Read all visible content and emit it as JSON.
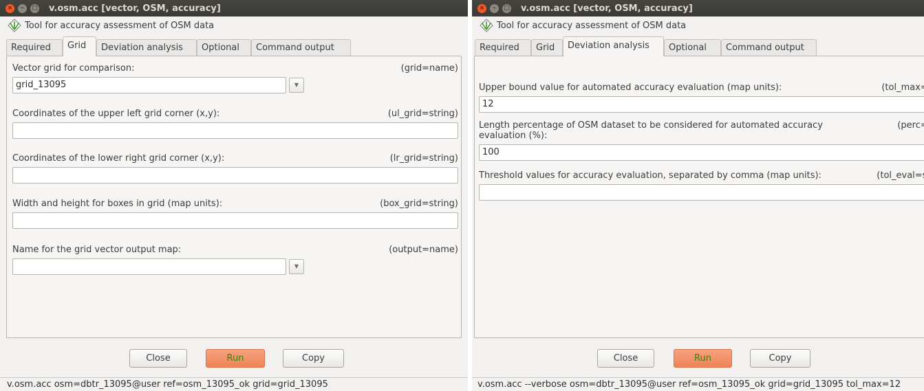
{
  "left": {
    "title": "v.osm.acc [vector, OSM, accuracy]",
    "description": "Tool for accuracy assessment of OSM data",
    "tabs": [
      "Required",
      "Grid",
      "Deviation analysis",
      "Optional",
      "Command output"
    ],
    "active_tab": "Grid",
    "fields": [
      {
        "label": "Vector grid for comparison:",
        "key": "(grid=name)",
        "value": ""
      },
      {
        "label": "Coordinates of the upper left grid corner (x,y):",
        "key": "(ul_grid=string)",
        "value": ""
      },
      {
        "label": "Coordinates of the lower right grid corner (x,y):",
        "key": "(lr_grid=string)",
        "value": ""
      },
      {
        "label": "Width and height for boxes in grid (map units):",
        "key": "(box_grid=string)",
        "value": ""
      },
      {
        "label": "Name for the grid vector output map:",
        "key": "(output=name)",
        "value": ""
      }
    ],
    "grid_value": "grid_13095",
    "buttons": {
      "close": "Close",
      "run": "Run",
      "copy": "Copy"
    },
    "command": "v.osm.acc osm=dbtr_13095@user ref=osm_13095_ok grid=grid_13095"
  },
  "right": {
    "title": "v.osm.acc [vector, OSM, accuracy]",
    "description": "Tool for accuracy assessment of OSM data",
    "tabs": [
      "Required",
      "Grid",
      "Deviation analysis",
      "Optional",
      "Command output"
    ],
    "active_tab": "Deviation analysis",
    "fields": [
      {
        "label": "Upper bound value for automated accuracy evaluation (map units):",
        "key": "(tol_max=float",
        "value": "12"
      },
      {
        "label": "Length percentage of OSM dataset to be considered for automated accuracy evaluation (%):",
        "key": "(perc=float",
        "value": "100"
      },
      {
        "label": "Threshold values for accuracy evaluation, separated by comma (map units):",
        "key": "(tol_eval=string",
        "value": ""
      }
    ],
    "buttons": {
      "close": "Close",
      "run": "Run",
      "copy": "Copy"
    },
    "command": "v.osm.acc --verbose osm=dbtr_13095@user ref=osm_13095_ok grid=grid_13095 tol_max=12"
  },
  "colors": {
    "titlebar": "#3c3b37",
    "close_button": "#f05a2a",
    "run_button": "#ef8458",
    "run_text": "#2f8a00"
  }
}
